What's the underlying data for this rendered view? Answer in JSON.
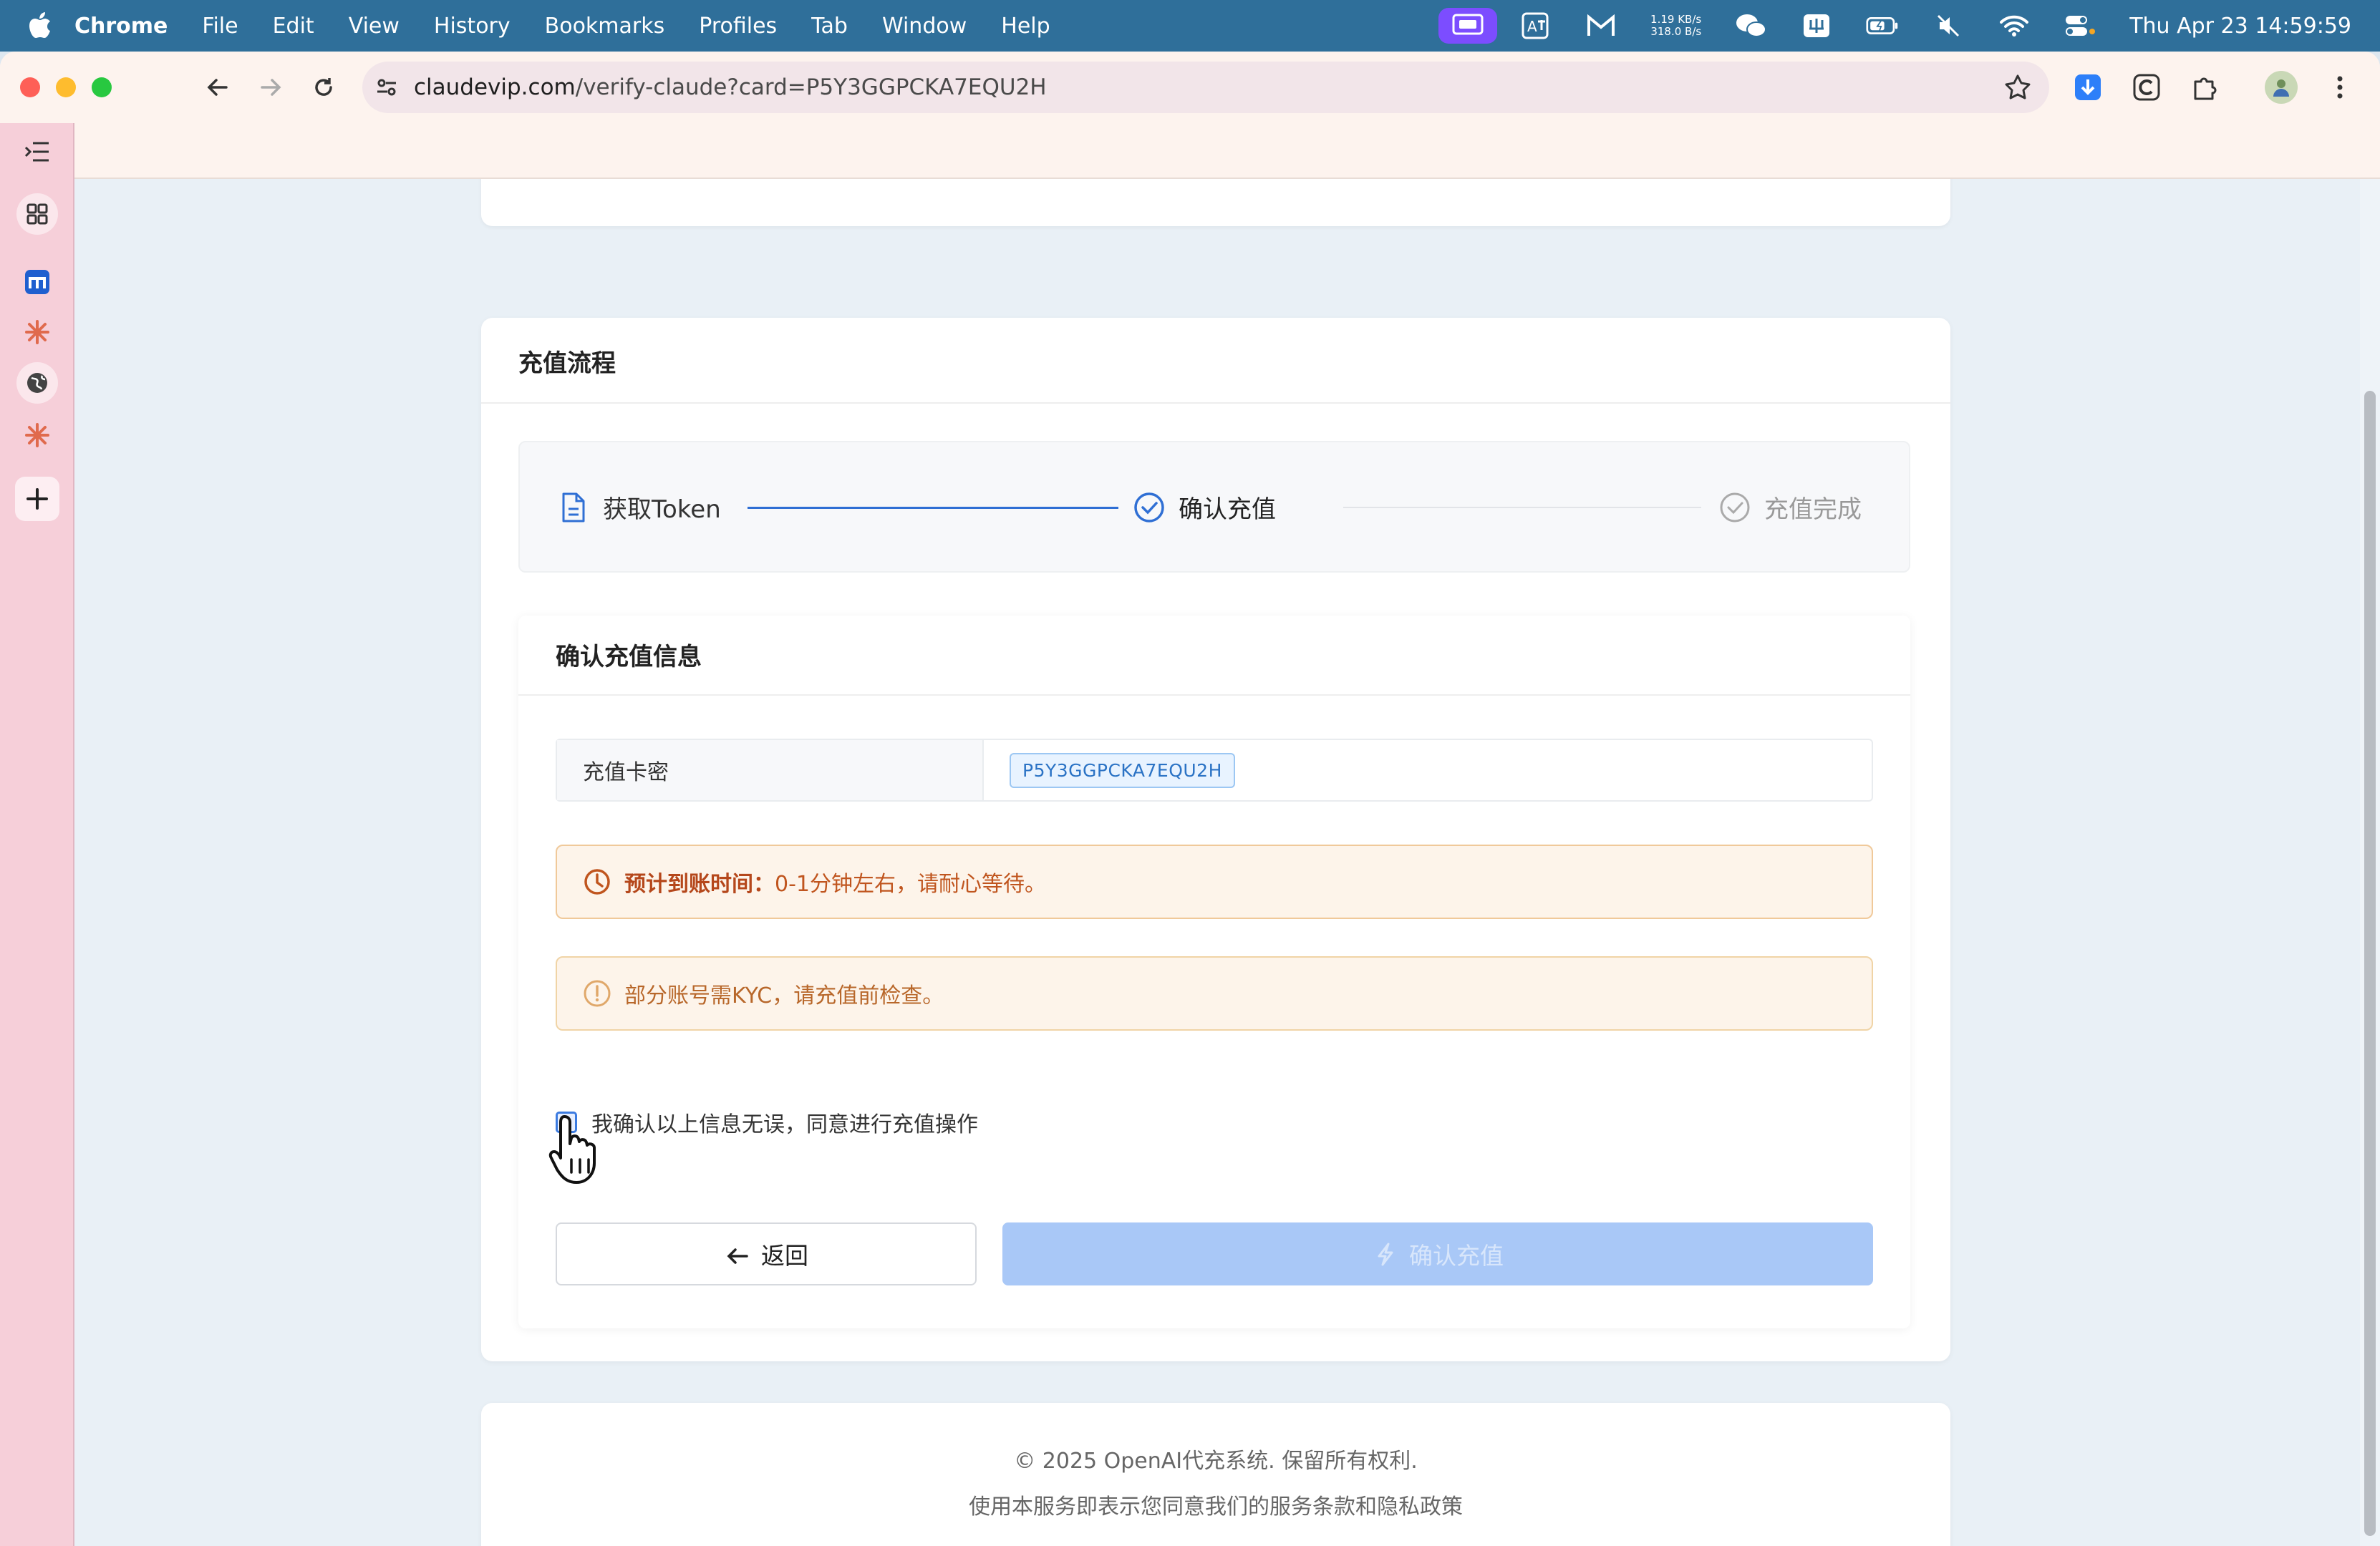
{
  "menubar": {
    "app": "Chrome",
    "items": [
      "File",
      "Edit",
      "View",
      "History",
      "Bookmarks",
      "Profiles",
      "Tab",
      "Window",
      "Help"
    ],
    "net_up": "1.19 KB/s",
    "net_down": "318.0 B/s",
    "clock": "Thu Apr 23  14:59:59"
  },
  "browser": {
    "url_host": "claudevip.com",
    "url_path": "/verify-claude?card=P5Y3GGPCKA7EQU2H"
  },
  "card": {
    "title": "充值流程"
  },
  "steps": [
    {
      "label": "获取Token",
      "state": "done"
    },
    {
      "label": "确认充值",
      "state": "active"
    },
    {
      "label": "充值完成",
      "state": "pending"
    }
  ],
  "confirm": {
    "title": "确认充值信息",
    "card_label": "充值卡密",
    "card_value": "P5Y3GGPCKA7EQU2H",
    "eta_label": "预计到账时间：",
    "eta_text": "0-1分钟左右，请耐心等待。",
    "kyc_text": "部分账号需KYC，请充值前检查。",
    "agree_text": "我确认以上信息无误，同意进行充值操作",
    "back_label": "返回",
    "submit_label": "确认充值"
  },
  "footer": {
    "copyright": "© 2025 OpenAI代充系统. 保留所有权利.",
    "terms": "使用本服务即表示您同意我们的服务条款和隐私政策"
  },
  "colors": {
    "accent": "#2f6fd4",
    "warning_text": "#c0551e",
    "warning_bg": "#fdf4ea",
    "disabled_button": "#a9c8f7",
    "menubar": "#2f6f9a",
    "sidebar": "#f6cfd9"
  }
}
